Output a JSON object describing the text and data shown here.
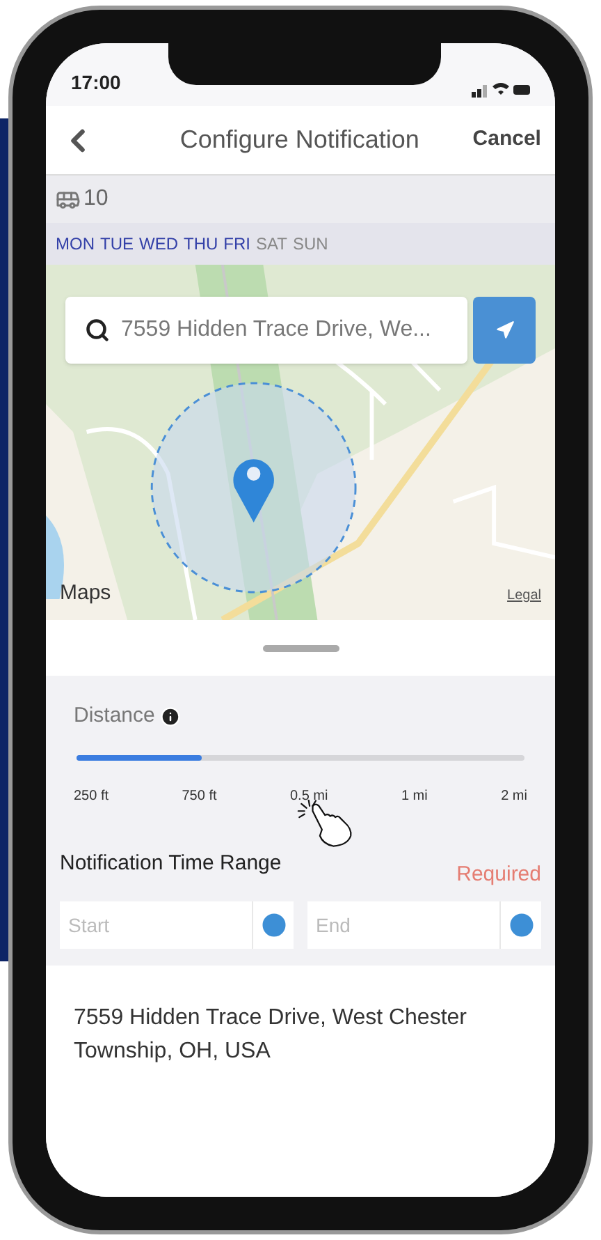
{
  "status_bar": {
    "time": "17:00"
  },
  "header": {
    "title": "Configure Notification",
    "cancel": "Cancel"
  },
  "route": {
    "number": "10"
  },
  "days": [
    {
      "label": "MON",
      "selected": true
    },
    {
      "label": "TUE",
      "selected": true
    },
    {
      "label": "WED",
      "selected": true
    },
    {
      "label": "THU",
      "selected": true
    },
    {
      "label": "FRI",
      "selected": true
    },
    {
      "label": "SAT",
      "selected": false
    },
    {
      "label": "SUN",
      "selected": false
    }
  ],
  "map": {
    "kind": "picture",
    "search_value": "7559 Hidden Trace Drive, We...",
    "attribution": "Maps",
    "legal": "Legal"
  },
  "distance": {
    "label": "Distance",
    "level": 0.28,
    "ticks": [
      "250 ft",
      "750 ft",
      "0.5 mi",
      "1 mi",
      "2 mi"
    ]
  },
  "time_range": {
    "label": "Notification Time Range",
    "required": "Required",
    "start_placeholder": "Start",
    "end_placeholder": "End"
  },
  "address": "7559 Hidden Trace Drive, West Chester Township, OH, USA"
}
